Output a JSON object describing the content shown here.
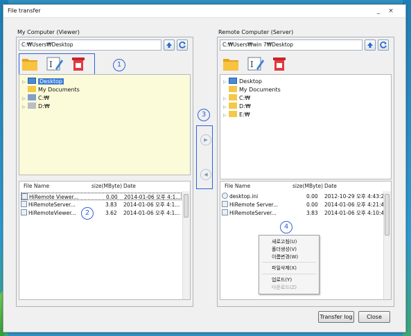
{
  "window": {
    "title": "File transfer",
    "minimize": "_",
    "close": "×"
  },
  "left": {
    "label": "My Computer (Viewer)",
    "path": "C:₩Users₩Desktop",
    "tree": [
      {
        "label": "Desktop",
        "selected": true
      },
      {
        "label": "My Documents"
      },
      {
        "label": "C:₩"
      },
      {
        "label": "D:₩"
      }
    ],
    "columns": [
      "File Name",
      "size(MByte)",
      "Date"
    ],
    "files": [
      {
        "name": "HiRemote Viewer...",
        "size": "0.00",
        "date": "2014-01-06 오후 4:1..."
      },
      {
        "name": "HiRemoteServer...",
        "size": "3.83",
        "date": "2014-01-06 오후 4:1..."
      },
      {
        "name": "HiRemoteViewer...",
        "size": "3.62",
        "date": "2014-01-06 오후 4:1..."
      }
    ]
  },
  "right": {
    "label": "Remote Computer (Server)",
    "path": "C:₩Users₩win 7₩Desktop",
    "tree": [
      {
        "label": "Desktop"
      },
      {
        "label": "My Documents"
      },
      {
        "label": "C:₩"
      },
      {
        "label": "D:₩"
      },
      {
        "label": "E:₩"
      }
    ],
    "columns": [
      "File Name",
      "size(MByte)",
      "Date"
    ],
    "files": [
      {
        "name": "desktop.ini",
        "size": "0.00",
        "date": "2012-10-29 오후 4:43:22"
      },
      {
        "name": "HiRemote Server...",
        "size": "0.00",
        "date": "2014-01-06 오후 4:21:44"
      },
      {
        "name": "HiRemoteServer...",
        "size": "3.83",
        "date": "2014-01-06 오후 4:10:44"
      }
    ]
  },
  "badges": [
    "1",
    "2",
    "3",
    "4"
  ],
  "transfer": {
    "to_right": "▶",
    "to_left": "◀"
  },
  "context_menu": {
    "refresh": "새로고침(U)",
    "new_folder": "폴더생성(V)",
    "rename": "이름변경(W)",
    "delete": "파일삭제(X)",
    "upload": "업로드(Y)",
    "download": "다운로드(Z)"
  },
  "buttons": {
    "transfer_log": "Transfer log",
    "close": "Close"
  },
  "colors": {
    "highlight": "#2f5fd8",
    "tree_bg": "#fbfbd9",
    "selection": "#3a7bd5"
  }
}
